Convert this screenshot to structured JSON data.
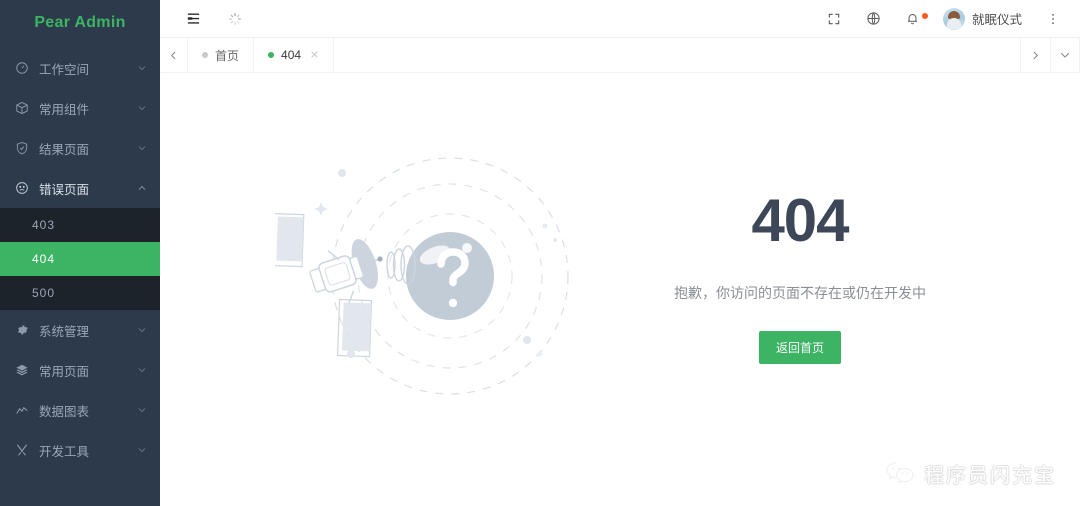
{
  "sidebar": {
    "logo": "Pear Admin",
    "logo_color": "#3cb464",
    "bg_color": "#2d3a4b",
    "submenu_bg_color": "#1d232b",
    "active_color": "#3cb464",
    "items": [
      {
        "label": "工作空间",
        "icon": "dashboard-icon",
        "expanded": false
      },
      {
        "label": "常用组件",
        "icon": "cube-icon",
        "expanded": false
      },
      {
        "label": "结果页面",
        "icon": "shield-check-icon",
        "expanded": false
      },
      {
        "label": "错误页面",
        "icon": "sad-face-icon",
        "expanded": true
      },
      {
        "label": "系统管理",
        "icon": "gear-icon",
        "expanded": false
      },
      {
        "label": "常用页面",
        "icon": "layers-icon",
        "expanded": false
      },
      {
        "label": "数据图表",
        "icon": "chart-line-icon",
        "expanded": false
      },
      {
        "label": "开发工具",
        "icon": "tools-icon",
        "expanded": false
      }
    ],
    "submenu": [
      {
        "label": "403",
        "active": false
      },
      {
        "label": "404",
        "active": true
      },
      {
        "label": "500",
        "active": false
      }
    ]
  },
  "topbar": {
    "menu_toggle_icon": "hamburger-icon",
    "refresh_icon": "loading-spinner-icon",
    "fullscreen_icon": "fullscreen-icon",
    "language_icon": "globe-icon",
    "notification_icon": "bell-icon",
    "notification_dot_color": "#ff5722",
    "avatar_icon": "user-avatar",
    "username": "就眠仪式",
    "more_icon": "more-vertical-icon"
  },
  "tabbar": {
    "prev_icon": "chevron-left-icon",
    "next_icon": "chevron-right-icon",
    "dropdown_icon": "chevron-down-icon",
    "tabs": [
      {
        "label": "首页",
        "active": false,
        "closable": false
      },
      {
        "label": "404",
        "active": true,
        "closable": true,
        "close_icon": "close-icon"
      }
    ]
  },
  "content": {
    "error_code": "404",
    "error_message": "抱歉，你访问的页面不存在或仍在开发中",
    "button_label": "返回首页",
    "button_color": "#3cb464",
    "illustration": "satellite-orbit-planet-question-mark"
  },
  "watermark": {
    "icon": "wechat-icon",
    "text": "程序员闪充宝"
  }
}
